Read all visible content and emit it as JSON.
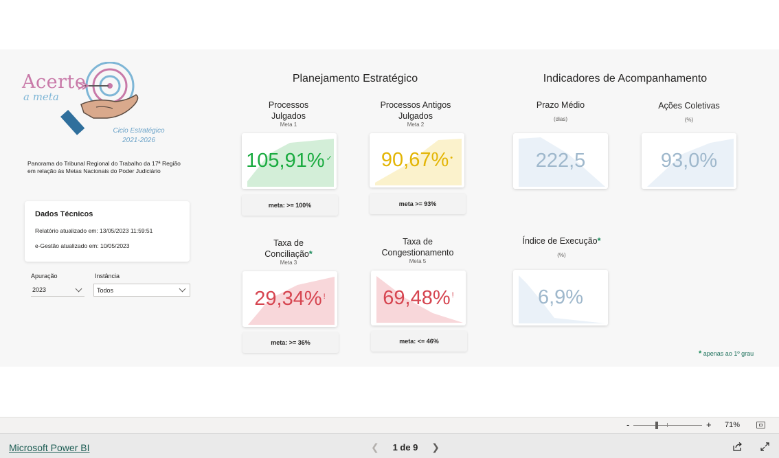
{
  "logo": {
    "title": "Acerte",
    "subtitle": "a meta",
    "cycle_line1": "Ciclo Estratégico",
    "cycle_line2": "2021-2026"
  },
  "panorama": "Panorama do Tribunal Regional do Trabalho da 17ª Região em relação às Metas Nacionais do Poder Judiciário",
  "dados_tecnicos": {
    "title": "Dados Técnicos",
    "relatorio": "Relatório atualizado em: 13/05/2023 11:59:51",
    "egestao": "e-Gestão atualizado em: 10/05/2023"
  },
  "filters": {
    "apuracao": {
      "label": "Apuração",
      "value": "2023"
    },
    "instancia": {
      "label": "Instância",
      "value": "Todos"
    }
  },
  "sections": {
    "planejamento": "Planejamento Estratégico",
    "indicadores": "Indicadores de Acompanhamento"
  },
  "kpis": {
    "meta1": {
      "label_1": "Processos",
      "label_2": "Julgados",
      "sub": "Meta 1",
      "value": "105,91%",
      "mark": "✓",
      "color": "#1aab40",
      "fill": "#d3eed8",
      "target": "meta: >= 100%"
    },
    "meta2": {
      "label_1": "Processos Antigos",
      "label_2": "Julgados",
      "sub": "Meta 2",
      "value": "90,67%",
      "mark": "•",
      "color": "#e3b505",
      "fill": "#fbf2cc",
      "target": "meta >= 93%"
    },
    "meta3": {
      "label_1": "Taxa de",
      "label_2": "Conciliação",
      "asterisk": "*",
      "sub": "Meta 3",
      "value": "29,34%",
      "mark": "!",
      "color": "#d64550",
      "fill": "#f8d7da",
      "target": "meta: >= 36%"
    },
    "meta5": {
      "label_1": "Taxa de",
      "label_2": "Congestionamento",
      "sub": "Meta 5",
      "value": "69,48%",
      "mark": "!",
      "color": "#d64550",
      "fill": "#f8d7da",
      "target": "meta: <= 46%"
    },
    "prazo": {
      "label": "Prazo Médio",
      "sub": "(dias)",
      "value": "222,5",
      "color": "#9fb8cc",
      "fill": "#eaf1f8"
    },
    "acoes": {
      "label": "Ações Coletivas",
      "sub": "(%)",
      "value": "93,0%",
      "color": "#9fb8cc",
      "fill": "#eaf1f8"
    },
    "execucao": {
      "label": "Índice de Execução",
      "asterisk": "*",
      "sub": "(%)",
      "value": "6,9%",
      "color": "#9fb8cc",
      "fill": "#eaf1f8"
    }
  },
  "footnote": {
    "asterisk": "*",
    "text": " apenas ao 1º grau"
  },
  "zoom": {
    "minus": "-",
    "plus": "+",
    "level": "71%"
  },
  "footer": {
    "brand": "Microsoft Power BI",
    "page": "1 de 9"
  }
}
